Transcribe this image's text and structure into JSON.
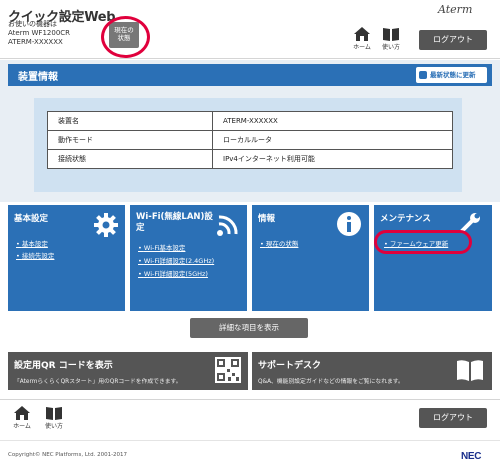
{
  "header": {
    "app_title": "クイック設定Web",
    "device_line1": "お使いの機器は",
    "device_line2": "Aterm WF1200CR",
    "device_line3": "ATERM-XXXXXX",
    "status_button": [
      "現在の",
      "状態"
    ],
    "logo": "Aterm",
    "home_label": "ホーム",
    "usage_label": "使い方",
    "logout_label": "ログアウト"
  },
  "panel": {
    "title": "装置情報",
    "refresh_label": "最新状態に更新",
    "rows": [
      {
        "label": "装置名",
        "value": "ATERM-XXXXXX"
      },
      {
        "label": "動作モード",
        "value": "ローカルルータ"
      },
      {
        "label": "接続状態",
        "value": "IPv4インターネット利用可能"
      }
    ]
  },
  "tiles": [
    {
      "title": "基本設定",
      "links": [
        "基本設定",
        "接続先設定"
      ]
    },
    {
      "title": "Wi-Fi(無線LAN)設定",
      "links": [
        "Wi-Fi基本設定",
        "Wi-Fi詳細設定(2.4GHz)",
        "Wi-Fi詳細設定(5GHz)"
      ]
    },
    {
      "title": "情報",
      "links": [
        "現在の状態"
      ]
    },
    {
      "title": "メンテナンス",
      "links": [
        "ファームウェア更新"
      ]
    }
  ],
  "details_button": "詳細な項目を表示",
  "qr_tile": {
    "title": "設定用QR コードを表示",
    "desc": "「AtermらくらくQRスタート」用のQRコードを作成できます。"
  },
  "support_tile": {
    "title": "サポートデスク",
    "desc": "Q&A、機能別設定ガイドなどの情報をご覧になれます。"
  },
  "footer": {
    "home_label": "ホーム",
    "usage_label": "使い方",
    "logout_label": "ログアウト",
    "copyright": "Copyright© NEC Platforms, Ltd. 2001-2017",
    "nec_logo": "NEC"
  },
  "colors": {
    "accent": "#2b70b6",
    "highlight": "#e0003c",
    "gray_button": "#555555"
  }
}
